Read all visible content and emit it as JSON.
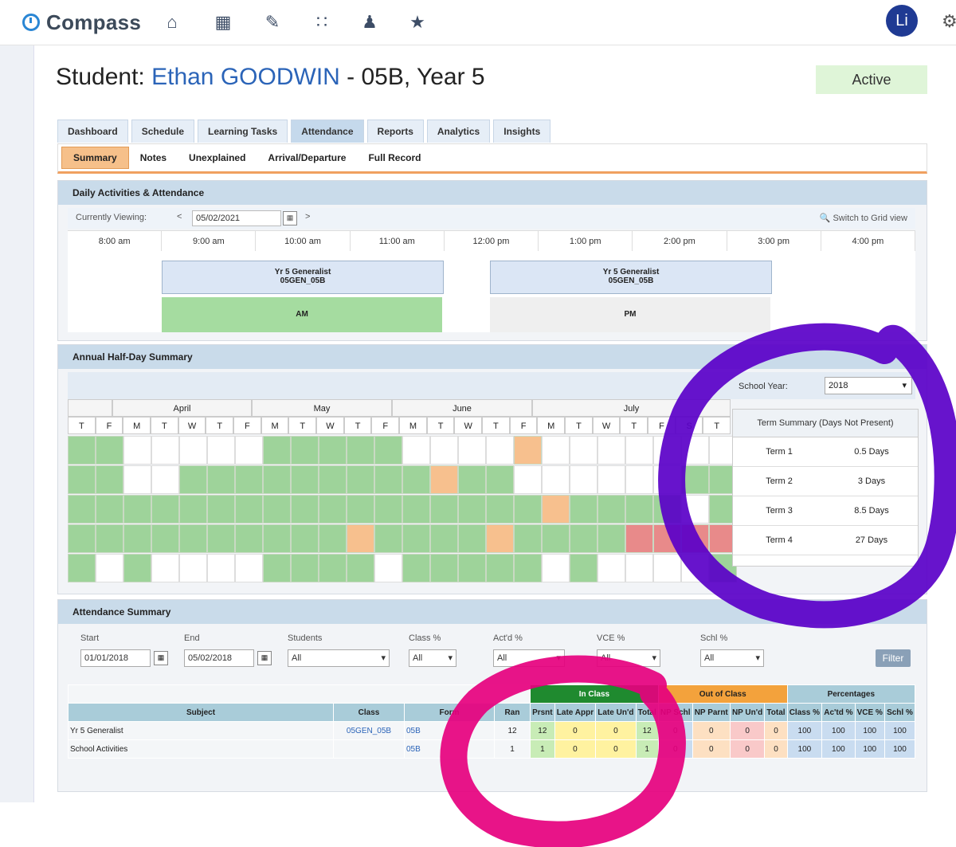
{
  "app": {
    "name": "Compass"
  },
  "header": {
    "nav_icons": [
      "home-icon",
      "calendar-icon",
      "pencil-icon",
      "grid-icon",
      "people-icon",
      "star-icon"
    ],
    "avatar_initial": "Li"
  },
  "student": {
    "prefix": "Student: ",
    "name": "Ethan GOODWIN",
    "suffix": " - 05B, Year 5",
    "status": "Active"
  },
  "tabs": [
    "Dashboard",
    "Schedule",
    "Learning Tasks",
    "Attendance",
    "Reports",
    "Analytics",
    "Insights"
  ],
  "active_tab": "Attendance",
  "subtabs": [
    "Summary",
    "Notes",
    "Unexplained",
    "Arrival/Departure",
    "Full Record"
  ],
  "active_subtab": "Summary",
  "daily": {
    "title": "Daily Activities & Attendance",
    "viewing_label": "Currently Viewing:",
    "date": "05/02/2021",
    "grid_view_link": "Switch to Grid view",
    "times": [
      "8:00 am",
      "9:00 am",
      "10:00 am",
      "11:00 am",
      "12:00 pm",
      "1:00 pm",
      "2:00 pm",
      "3:00 pm",
      "4:00 pm"
    ],
    "class1_line1": "Yr 5 Generalist",
    "class1_line2": "05GEN_05B",
    "class2_line1": "Yr 5 Generalist",
    "class2_line2": "05GEN_05B",
    "am_label": "AM",
    "pm_label": "PM",
    "colors": {
      "present": "#a5dca0",
      "none": "#efefef"
    }
  },
  "half_day": {
    "title": "Annual Half-Day Summary",
    "months": [
      "April",
      "May",
      "June",
      "July"
    ],
    "days": [
      "T",
      "F",
      "M",
      "T",
      "W",
      "T",
      "F",
      "M",
      "T",
      "W",
      "T",
      "F",
      "M",
      "T",
      "W",
      "T",
      "F",
      "M",
      "T",
      "W",
      "T",
      "F",
      "S",
      "T"
    ],
    "year_label": "School Year:",
    "year": "2018",
    "term_summary_title": "Term Summary (Days Not Present)",
    "terms": [
      {
        "term": "Term 1",
        "days": "0.5 Days"
      },
      {
        "term": "Term 2",
        "days": "3 Days"
      },
      {
        "term": "Term 3",
        "days": "8.5 Days"
      },
      {
        "term": "Term 4",
        "days": "27 Days"
      }
    ]
  },
  "attendance_summary": {
    "title": "Attendance Summary",
    "filters": {
      "start_label": "Start",
      "start_value": "01/01/2018",
      "end_label": "End",
      "end_value": "05/02/2018",
      "students_label": "Students",
      "students_value": "All",
      "class_pct_label": "Class %",
      "class_pct_value": "All",
      "actd_pct_label": "Act'd %",
      "actd_pct_value": "All",
      "vce_pct_label": "VCE %",
      "vce_pct_value": "All",
      "schl_pct_label": "Schl %",
      "schl_pct_value": "All",
      "filter_button": "Filter"
    },
    "groups": {
      "in_class": "In Class",
      "out_of_class": "Out of Class",
      "percentages": "Percentages"
    },
    "columns": [
      "Subject",
      "Class",
      "Form",
      "Ran",
      "Prsnt",
      "Late Appr",
      "Late Un'd",
      "Total",
      "NP Schl",
      "NP Parnt",
      "NP Un'd",
      "Total",
      "Class %",
      "Ac'td %",
      "VCE %",
      "Schl %"
    ],
    "rows": [
      [
        "Yr 5 Generalist",
        "05GEN_05B",
        "05B",
        "12",
        "12",
        "0",
        "0",
        "12",
        "0",
        "0",
        "0",
        "0",
        "100",
        "100",
        "100",
        "100"
      ],
      [
        "School Activities",
        "",
        "05B",
        "1",
        "1",
        "0",
        "0",
        "1",
        "0",
        "0",
        "0",
        "0",
        "100",
        "100",
        "100",
        "100"
      ]
    ]
  },
  "annotation_colors": {
    "purple": "#5a00c8",
    "pink": "#e6007e"
  }
}
